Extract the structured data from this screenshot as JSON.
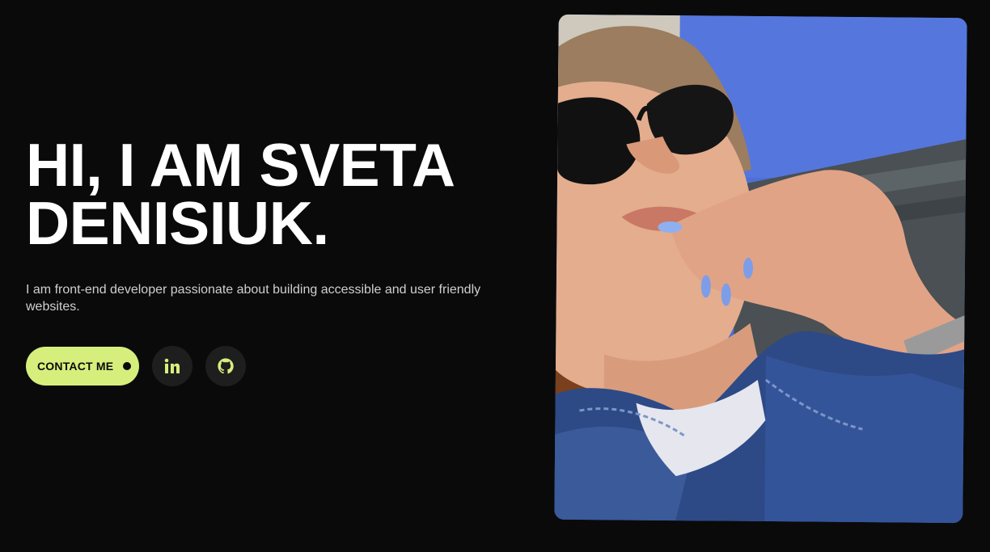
{
  "hero": {
    "headline_line1": "HI, I AM SVETA",
    "headline_line2": "DENISIUK.",
    "intro": "I am front-end developer passionate about building accessible and user friendly websites."
  },
  "actions": {
    "contact_label": "CONTACT ME",
    "social": [
      {
        "name": "linkedin",
        "icon": "linkedin-icon"
      },
      {
        "name": "github",
        "icon": "github-icon"
      }
    ]
  },
  "photo": {
    "subject": "portrait-photo"
  },
  "colors": {
    "background": "#0a0a0a",
    "accent": "#d6ef7c",
    "text": "#ffffff",
    "muted_text": "#cfcfcf",
    "icon_bg": "#1e1e1e"
  }
}
